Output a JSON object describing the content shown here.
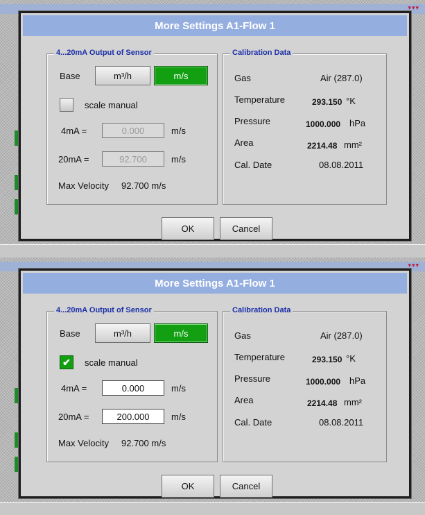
{
  "background": {
    "arrows": "▾▾▾"
  },
  "dialogs": [
    {
      "title": "More Settings A1-Flow 1",
      "output_group": {
        "legend": "4...20mA Output of Sensor",
        "base_label": "Base",
        "base_options": [
          "m³/h",
          "m/s"
        ],
        "base_selected": "m/s",
        "scale_manual_label": "scale manual",
        "scale_manual_checked": false,
        "mA4_label": "4mA =",
        "mA4_value": "0.000",
        "mA4_unit": "m/s",
        "mA20_label": "20mA =",
        "mA20_value": "92.700",
        "mA20_unit": "m/s",
        "max_velocity_label": "Max Velocity",
        "max_velocity_value": "92.700 m/s"
      },
      "calibration_group": {
        "legend": "Calibration Data",
        "gas_label": "Gas",
        "gas_value": "Air (287.0)",
        "temperature_label": "Temperature",
        "temperature_value": "293.150",
        "temperature_unit": "°K",
        "pressure_label": "Pressure",
        "pressure_value": "1000.000",
        "pressure_unit": "hPa",
        "area_label": "Area",
        "area_value": "2214.48",
        "area_unit": "mm²",
        "cal_date_label": "Cal. Date",
        "cal_date_value": "08.08.2011"
      },
      "ok_label": "OK",
      "cancel_label": "Cancel"
    },
    {
      "title": "More Settings A1-Flow 1",
      "output_group": {
        "legend": "4...20mA Output of Sensor",
        "base_label": "Base",
        "base_options": [
          "m³/h",
          "m/s"
        ],
        "base_selected": "m/s",
        "scale_manual_label": "scale manual",
        "scale_manual_checked": true,
        "mA4_label": "4mA =",
        "mA4_value": "0.000",
        "mA4_unit": "m/s",
        "mA20_label": "20mA =",
        "mA20_value": "200.000",
        "mA20_unit": "m/s",
        "max_velocity_label": "Max Velocity",
        "max_velocity_value": "92.700 m/s"
      },
      "calibration_group": {
        "legend": "Calibration Data",
        "gas_label": "Gas",
        "gas_value": "Air (287.0)",
        "temperature_label": "Temperature",
        "temperature_value": "293.150",
        "temperature_unit": "°K",
        "pressure_label": "Pressure",
        "pressure_value": "1000.000",
        "pressure_unit": "hPa",
        "area_label": "Area",
        "area_value": "2214.48",
        "area_unit": "mm²",
        "cal_date_label": "Cal. Date",
        "cal_date_value": "08.08.2011"
      },
      "ok_label": "OK",
      "cancel_label": "Cancel"
    }
  ],
  "colors": {
    "title_bar": "#95aee0",
    "selected_button": "#12a012",
    "group_legend": "#1a2ea8"
  }
}
